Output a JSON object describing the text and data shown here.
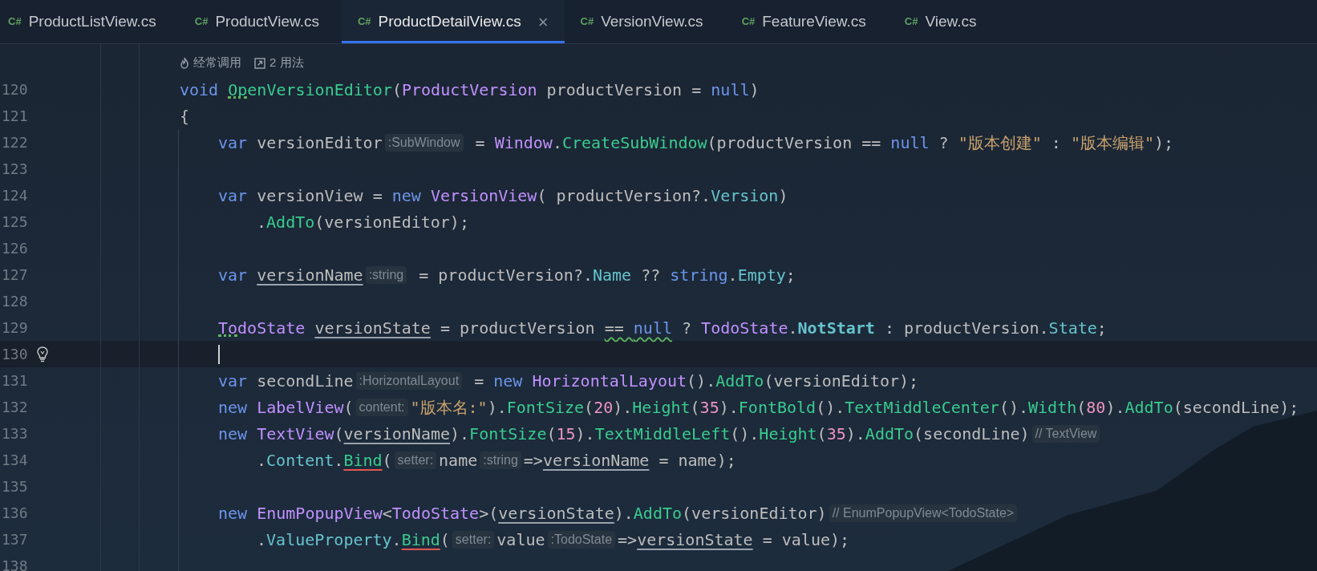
{
  "tabs": [
    {
      "badge": "C#",
      "label": "ProductListView.cs",
      "selected": false
    },
    {
      "badge": "C#",
      "label": "ProductView.cs",
      "selected": false
    },
    {
      "badge": "C#",
      "label": "ProductDetailView.cs",
      "selected": true,
      "close": "×"
    },
    {
      "badge": "C#",
      "label": "VersionView.cs",
      "selected": false
    },
    {
      "badge": "C#",
      "label": "FeatureView.cs",
      "selected": false
    },
    {
      "badge": "C#",
      "label": "View.cs",
      "selected": false
    }
  ],
  "code_lens": [
    {
      "kind": "hot",
      "label": "经常调用"
    },
    {
      "kind": "usages",
      "label": "2 用法"
    }
  ],
  "lines": [
    {
      "number": "120",
      "current": false,
      "tokens": [
        {
          "text": "void ",
          "kind": "kw"
        },
        {
          "text": "OpenVersionEditor",
          "kind": "method",
          "dotted": true
        },
        {
          "text": "(",
          "kind": "plain"
        },
        {
          "text": "ProductVersion",
          "kind": "type"
        },
        {
          "text": " productVersion = ",
          "kind": "plain"
        },
        {
          "text": "null",
          "kind": "kw"
        },
        {
          "text": ")",
          "kind": "plain"
        }
      ]
    },
    {
      "number": "121",
      "current": false,
      "tokens": [
        {
          "text": "{",
          "kind": "plain"
        }
      ],
      "children": [
        {
          "number": "122",
          "current": false,
          "tokens": [
            {
              "text": "var",
              "kind": "kw"
            },
            {
              "text": " versionEditor",
              "kind": "plain"
            },
            {
              "text": ":SubWindow",
              "kind": "hint"
            },
            {
              "text": " = ",
              "kind": "plain"
            },
            {
              "text": "Window",
              "kind": "type"
            },
            {
              "text": ".",
              "kind": "plain"
            },
            {
              "text": "CreateSubWindow",
              "kind": "method"
            },
            {
              "text": "(productVersion == ",
              "kind": "plain"
            },
            {
              "text": "null",
              "kind": "kw"
            },
            {
              "text": " ? ",
              "kind": "plain"
            },
            {
              "text": "\"版本创建\"",
              "kind": "str"
            },
            {
              "text": " : ",
              "kind": "plain"
            },
            {
              "text": "\"版本编辑\"",
              "kind": "str"
            },
            {
              "text": ");",
              "kind": "plain"
            }
          ]
        },
        {
          "number": "123",
          "current": false
        },
        {
          "number": "124",
          "current": false,
          "tokens": [
            {
              "text": "var",
              "kind": "kw"
            },
            {
              "text": " versionView = ",
              "kind": "plain"
            },
            {
              "text": "new ",
              "kind": "kw"
            },
            {
              "text": "VersionView",
              "kind": "type"
            },
            {
              "text": "( productVersion?.",
              "kind": "plain"
            },
            {
              "text": "Version",
              "kind": "prop"
            },
            {
              "text": ")",
              "kind": "plain"
            }
          ],
          "children": [
            {
              "number": "125",
              "current": false,
              "tokens": [
                {
                  "text": ".",
                  "kind": "plain"
                },
                {
                  "text": "AddTo",
                  "kind": "method"
                },
                {
                  "text": "(versionEditor);",
                  "kind": "plain"
                }
              ]
            }
          ]
        },
        {
          "number": "126",
          "current": false
        },
        {
          "number": "127",
          "current": false,
          "tokens": [
            {
              "text": "var ",
              "kind": "kw"
            },
            {
              "text": "versionName",
              "kind": "plain",
              "underlined": true
            },
            {
              "text": ":string",
              "kind": "hint"
            },
            {
              "text": " = productVersion?.",
              "kind": "plain"
            },
            {
              "text": "Name",
              "kind": "prop"
            },
            {
              "text": " ?? ",
              "kind": "plain"
            },
            {
              "text": "string",
              "kind": "kw"
            },
            {
              "text": ".",
              "kind": "plain"
            },
            {
              "text": "Empty",
              "kind": "prop"
            },
            {
              "text": ";",
              "kind": "plain"
            }
          ]
        },
        {
          "number": "128",
          "current": false
        },
        {
          "number": "129",
          "current": false,
          "tokens": [
            {
              "text": "TodoState ",
              "kind": "type",
              "dotted": true
            },
            {
              "text": "versionState",
              "kind": "plain",
              "underlined": true
            },
            {
              "text": " = productVersion ",
              "kind": "plain"
            },
            {
              "text": "== ",
              "kind": "plain",
              "warning": true
            },
            {
              "text": "null",
              "kind": "kw",
              "warning": true
            },
            {
              "text": " ? ",
              "kind": "plain"
            },
            {
              "text": "TodoState",
              "kind": "type"
            },
            {
              "text": ".",
              "kind": "plain"
            },
            {
              "text": "NotStart",
              "kind": "const"
            },
            {
              "text": " : productVersion.",
              "kind": "plain"
            },
            {
              "text": "State",
              "kind": "prop"
            },
            {
              "text": ";",
              "kind": "plain"
            }
          ]
        },
        {
          "number": "130",
          "current": true
        },
        {
          "number": "131",
          "current": false,
          "tokens": [
            {
              "text": "var",
              "kind": "kw"
            },
            {
              "text": " secondLine",
              "kind": "plain"
            },
            {
              "text": ":HorizontalLayout",
              "kind": "hint"
            },
            {
              "text": " = ",
              "kind": "plain"
            },
            {
              "text": "new ",
              "kind": "kw"
            },
            {
              "text": "HorizontalLayout",
              "kind": "type"
            },
            {
              "text": "().",
              "kind": "plain"
            },
            {
              "text": "AddTo",
              "kind": "method"
            },
            {
              "text": "(versionEditor);",
              "kind": "plain"
            }
          ]
        },
        {
          "number": "132",
          "current": false,
          "tokens": [
            {
              "text": "new ",
              "kind": "kw"
            },
            {
              "text": "LabelView",
              "kind": "type"
            },
            {
              "text": "(",
              "kind": "plain"
            },
            {
              "text": "content:",
              "kind": "hint"
            },
            {
              "text": "\"版本名:\"",
              "kind": "str"
            },
            {
              "text": ").",
              "kind": "plain"
            },
            {
              "text": "FontSize",
              "kind": "method"
            },
            {
              "text": "(",
              "kind": "plain"
            },
            {
              "text": "20",
              "kind": "num"
            },
            {
              "text": ").",
              "kind": "plain"
            },
            {
              "text": "Height",
              "kind": "method"
            },
            {
              "text": "(",
              "kind": "plain"
            },
            {
              "text": "35",
              "kind": "num"
            },
            {
              "text": ").",
              "kind": "plain"
            },
            {
              "text": "FontBold",
              "kind": "method"
            },
            {
              "text": "().",
              "kind": "plain"
            },
            {
              "text": "TextMiddleCenter",
              "kind": "method"
            },
            {
              "text": "().",
              "kind": "plain"
            },
            {
              "text": "Width",
              "kind": "method"
            },
            {
              "text": "(",
              "kind": "plain"
            },
            {
              "text": "80",
              "kind": "num"
            },
            {
              "text": ").",
              "kind": "plain"
            },
            {
              "text": "AddTo",
              "kind": "method"
            },
            {
              "text": "(secondLine);",
              "kind": "plain"
            }
          ]
        },
        {
          "number": "133",
          "current": false,
          "tokens": [
            {
              "text": "new ",
              "kind": "kw"
            },
            {
              "text": "TextView",
              "kind": "type"
            },
            {
              "text": "(",
              "kind": "plain"
            },
            {
              "text": "versionName",
              "kind": "plain",
              "underlined": true
            },
            {
              "text": ").",
              "kind": "plain"
            },
            {
              "text": "FontSize",
              "kind": "method"
            },
            {
              "text": "(",
              "kind": "plain"
            },
            {
              "text": "15",
              "kind": "num"
            },
            {
              "text": ").",
              "kind": "plain"
            },
            {
              "text": "TextMiddleLeft",
              "kind": "method"
            },
            {
              "text": "().",
              "kind": "plain"
            },
            {
              "text": "Height",
              "kind": "method"
            },
            {
              "text": "(",
              "kind": "plain"
            },
            {
              "text": "35",
              "kind": "num"
            },
            {
              "text": ").",
              "kind": "plain"
            },
            {
              "text": "AddTo",
              "kind": "method"
            },
            {
              "text": "(secondLine)",
              "kind": "plain"
            },
            {
              "text": "// TextView",
              "kind": "hint"
            }
          ],
          "children": [
            {
              "number": "134",
              "current": false,
              "tokens": [
                {
                  "text": ".",
                  "kind": "plain"
                },
                {
                  "text": "Content",
                  "kind": "prop"
                },
                {
                  "text": ".",
                  "kind": "plain"
                },
                {
                  "text": "Bind",
                  "kind": "method",
                  "error": true
                },
                {
                  "text": "(",
                  "kind": "plain"
                },
                {
                  "text": "setter:",
                  "kind": "hint"
                },
                {
                  "text": "name",
                  "kind": "plain"
                },
                {
                  "text": ":string",
                  "kind": "hint"
                },
                {
                  "text": "=>",
                  "kind": "plain"
                },
                {
                  "text": "versionName",
                  "kind": "plain",
                  "underlined": true
                },
                {
                  "text": " = name);",
                  "kind": "plain"
                }
              ]
            }
          ]
        },
        {
          "number": "135",
          "current": false
        },
        {
          "number": "136",
          "current": false,
          "tokens": [
            {
              "text": "new ",
              "kind": "kw"
            },
            {
              "text": "EnumPopupView",
              "kind": "type"
            },
            {
              "text": "<",
              "kind": "plain"
            },
            {
              "text": "TodoState",
              "kind": "type"
            },
            {
              "text": ">(",
              "kind": "plain"
            },
            {
              "text": "versionState",
              "kind": "plain",
              "underlined": true
            },
            {
              "text": ").",
              "kind": "plain"
            },
            {
              "text": "AddTo",
              "kind": "method"
            },
            {
              "text": "(versionEditor)",
              "kind": "plain"
            },
            {
              "text": "// EnumPopupView<TodoState>",
              "kind": "hint"
            }
          ],
          "children": [
            {
              "number": "137",
              "current": false,
              "tokens": [
                {
                  "text": ".",
                  "kind": "plain"
                },
                {
                  "text": "ValueProperty",
                  "kind": "prop"
                },
                {
                  "text": ".",
                  "kind": "plain"
                },
                {
                  "text": "Bind",
                  "kind": "method",
                  "error": true
                },
                {
                  "text": "(",
                  "kind": "plain"
                },
                {
                  "text": "setter:",
                  "kind": "hint"
                },
                {
                  "text": "value",
                  "kind": "plain"
                },
                {
                  "text": ":TodoState",
                  "kind": "hint"
                },
                {
                  "text": "=>",
                  "kind": "plain"
                },
                {
                  "text": "versionState",
                  "kind": "plain",
                  "underlined": true
                },
                {
                  "text": " = value);",
                  "kind": "plain"
                }
              ]
            }
          ]
        },
        {
          "number": "138",
          "current": false
        }
      ]
    }
  ]
}
